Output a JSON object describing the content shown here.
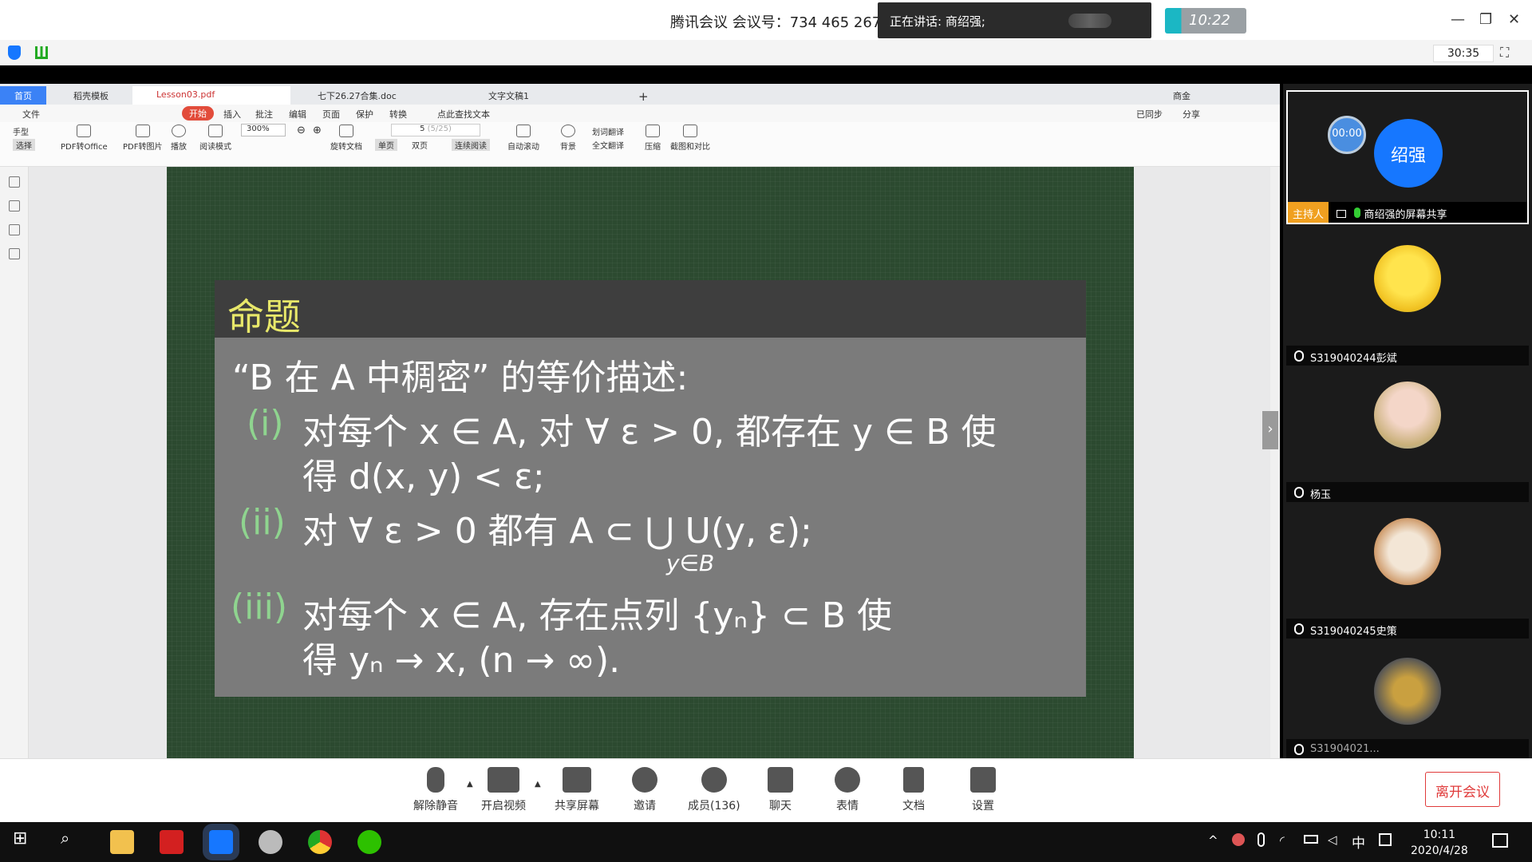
{
  "meeting": {
    "title": "腾讯会议 会议号：734 465 267",
    "speaking": "正在讲话: 商绍强;",
    "clock": "10:22",
    "elapsed": "30:35"
  },
  "wps": {
    "tabs": [
      "首页",
      "稻壳模板",
      "Lesson03.pdf",
      "七下26.27合集.doc",
      "文字文稿1"
    ],
    "menu": [
      "文件",
      "开始",
      "插入",
      "批注",
      "编辑",
      "页面",
      "保护",
      "转换",
      "点此查找文本",
      "已同步",
      "分享"
    ],
    "toolbar": {
      "hand": "手型",
      "select": "选择",
      "pdf_office": "PDF转Office",
      "pdf_img": "PDF转图片",
      "play": "播放",
      "read": "阅读模式",
      "zoom": "300%",
      "rotate": "旋转文档",
      "page": "5",
      "page_total": "(5/25)",
      "single": "单页",
      "double": "双页",
      "continuous": "连续阅读",
      "autoscroll": "自动滚动",
      "bg": "背景",
      "word_trans": "划词翻译",
      "full_trans": "全文翻译",
      "compress": "压缩",
      "compare": "截图和对比"
    },
    "user": "商金"
  },
  "slide": {
    "heading": "命题",
    "intro": "“B 在 A 中稠密” 的等价描述:",
    "item1_num": "(i)",
    "item1_l1": "对每个 x ∈ A, 对 ∀ ε > 0, 都存在 y ∈ B 使",
    "item1_l2": "得 d(x, y) < ε;",
    "item2_num": "(ii)",
    "item2": "对 ∀ ε > 0 都有 A ⊂ ⋃ U(y, ε);",
    "item2_sub": "y∈B",
    "item3_num": "(iii)",
    "item3_l1": "对每个 x ∈ A, 存在点列 {yₙ} ⊂ B 使",
    "item3_l2": "得 yₙ → x, (n → ∞)."
  },
  "participants": {
    "host_badge": "主持人",
    "host_avatar": "绍强",
    "host_timer": "00:00",
    "host_label": "商绍强的屏幕共享",
    "others": [
      "S319040244彭斌",
      "杨玉",
      "S319040245史策",
      "S31904021..."
    ]
  },
  "controls": {
    "unmute": "解除静音",
    "video": "开启视频",
    "share": "共享屏幕",
    "invite": "邀请",
    "members": "成员(136)",
    "chat": "聊天",
    "emoji": "表情",
    "docs": "文档",
    "settings": "设置",
    "leave": "离开会议"
  },
  "taskbar": {
    "time": "10:11",
    "date": "2020/4/28",
    "ime": "中"
  },
  "colors": {
    "slide_bg": "#2c4a30",
    "box": "#7b7b7b",
    "heading": "#e8e86a",
    "number": "#8fd48f",
    "leave": "#e03a3a",
    "avatar_blue": "#1677ff"
  }
}
